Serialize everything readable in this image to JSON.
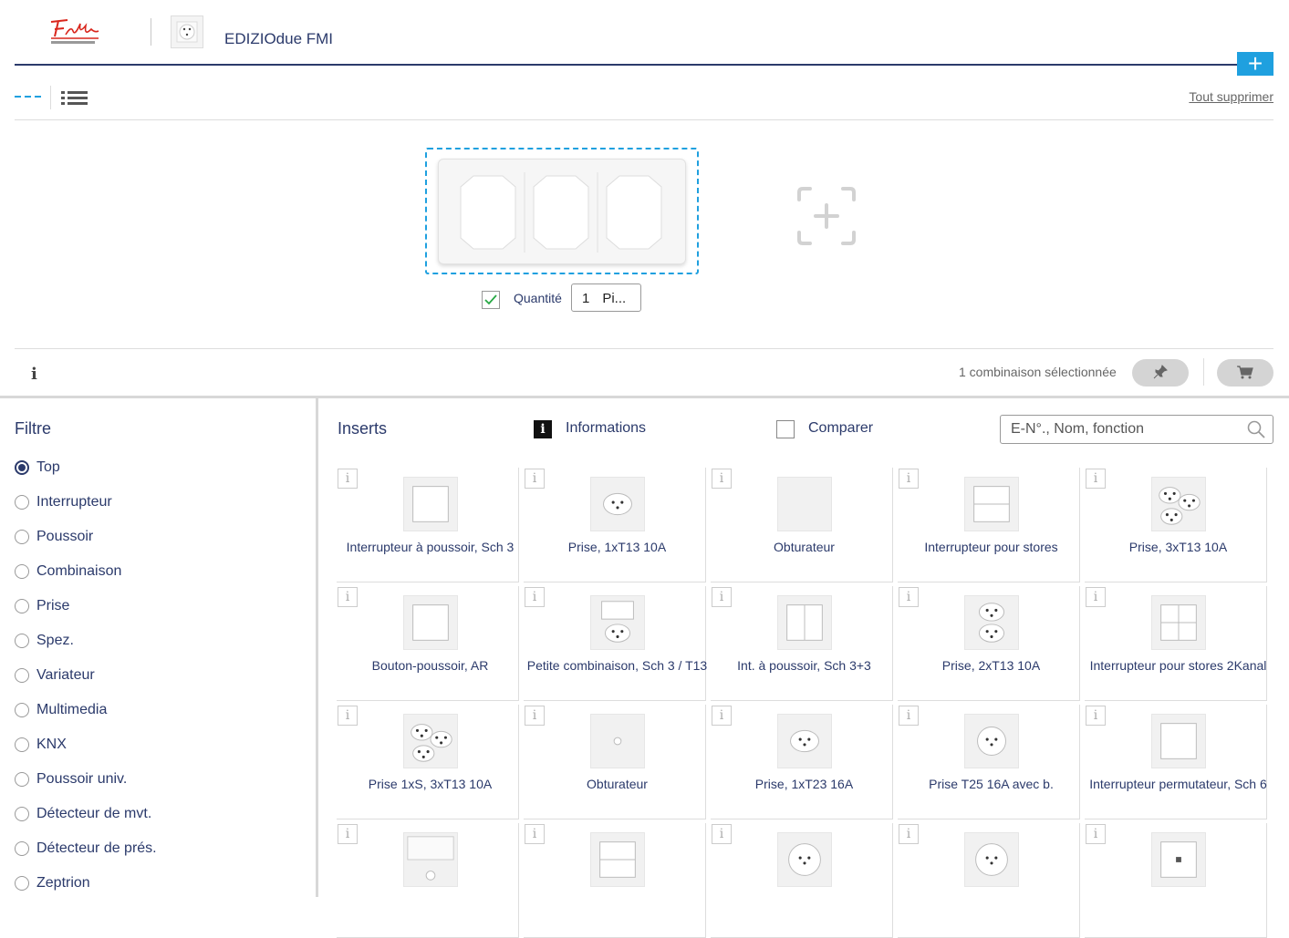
{
  "header": {
    "title": "EDIZIOdue FMI",
    "logo_text": "Feller by Schneider Electric",
    "add_label": "+"
  },
  "toolbar": {
    "clear_all": "Tout supprimer"
  },
  "config": {
    "quantity_label": "Quantité",
    "quantity_value": "1",
    "quantity_unit": "Pi...",
    "quantity_checked": true
  },
  "status": {
    "info": "i",
    "selection_count": "1 combinaison sélectionnée"
  },
  "filter": {
    "title": "Filtre",
    "items": [
      {
        "label": "Top",
        "selected": true
      },
      {
        "label": "Interrupteur",
        "selected": false
      },
      {
        "label": "Poussoir",
        "selected": false
      },
      {
        "label": "Combinaison",
        "selected": false
      },
      {
        "label": "Prise",
        "selected": false
      },
      {
        "label": "Spez.",
        "selected": false
      },
      {
        "label": "Variateur",
        "selected": false
      },
      {
        "label": "Multimedia",
        "selected": false
      },
      {
        "label": "KNX",
        "selected": false
      },
      {
        "label": "Poussoir univ.",
        "selected": false
      },
      {
        "label": "Détecteur de mvt.",
        "selected": false
      },
      {
        "label": "Détecteur de prés.",
        "selected": false
      },
      {
        "label": "Zeptrion",
        "selected": false
      }
    ]
  },
  "inserts": {
    "title": "Inserts",
    "info_label": "Informations",
    "compare_label": "Comparer",
    "search_placeholder": "E-N°., Nom, fonction",
    "info_glyph": "i",
    "products": [
      {
        "label": "Interrupteur à poussoir, Sch 3",
        "icon": "switch-plate-icon"
      },
      {
        "label": "Prise, 1xT13 10A",
        "icon": "socket-icon"
      },
      {
        "label": "Obturateur",
        "icon": "blank-plate-icon"
      },
      {
        "label": "Interrupteur pour stores",
        "icon": "blind-switch-icon"
      },
      {
        "label": "Prise, 3xT13 10A",
        "icon": "triple-socket-icon"
      },
      {
        "label": "Bouton-poussoir, AR",
        "icon": "switch-plate-icon"
      },
      {
        "label": "Petite combinaison, Sch 3 / T13",
        "icon": "combo-icon"
      },
      {
        "label": "Int. à poussoir, Sch 3+3",
        "icon": "double-switch-icon"
      },
      {
        "label": "Prise, 2xT13 10A",
        "icon": "double-socket-icon"
      },
      {
        "label": "Interrupteur pour stores 2Kanal",
        "icon": "quad-switch-icon"
      },
      {
        "label": "Prise 1xS, 3xT13 10A",
        "icon": "triple-socket-icon"
      },
      {
        "label": "Obturateur",
        "icon": "blank-hole-icon"
      },
      {
        "label": "Prise, 1xT23 16A",
        "icon": "socket-icon"
      },
      {
        "label": "Prise T25 16A avec b.",
        "icon": "socket-t25-icon"
      },
      {
        "label": "Interrupteur permutateur, Sch 6",
        "icon": "switch-plate-icon"
      },
      {
        "label": "",
        "icon": "motion-detector-icon"
      },
      {
        "label": "",
        "icon": "blind-switch-icon"
      },
      {
        "label": "",
        "icon": "socket-round-icon"
      },
      {
        "label": "",
        "icon": "socket-round-icon"
      },
      {
        "label": "",
        "icon": "button-dot-icon"
      }
    ]
  }
}
